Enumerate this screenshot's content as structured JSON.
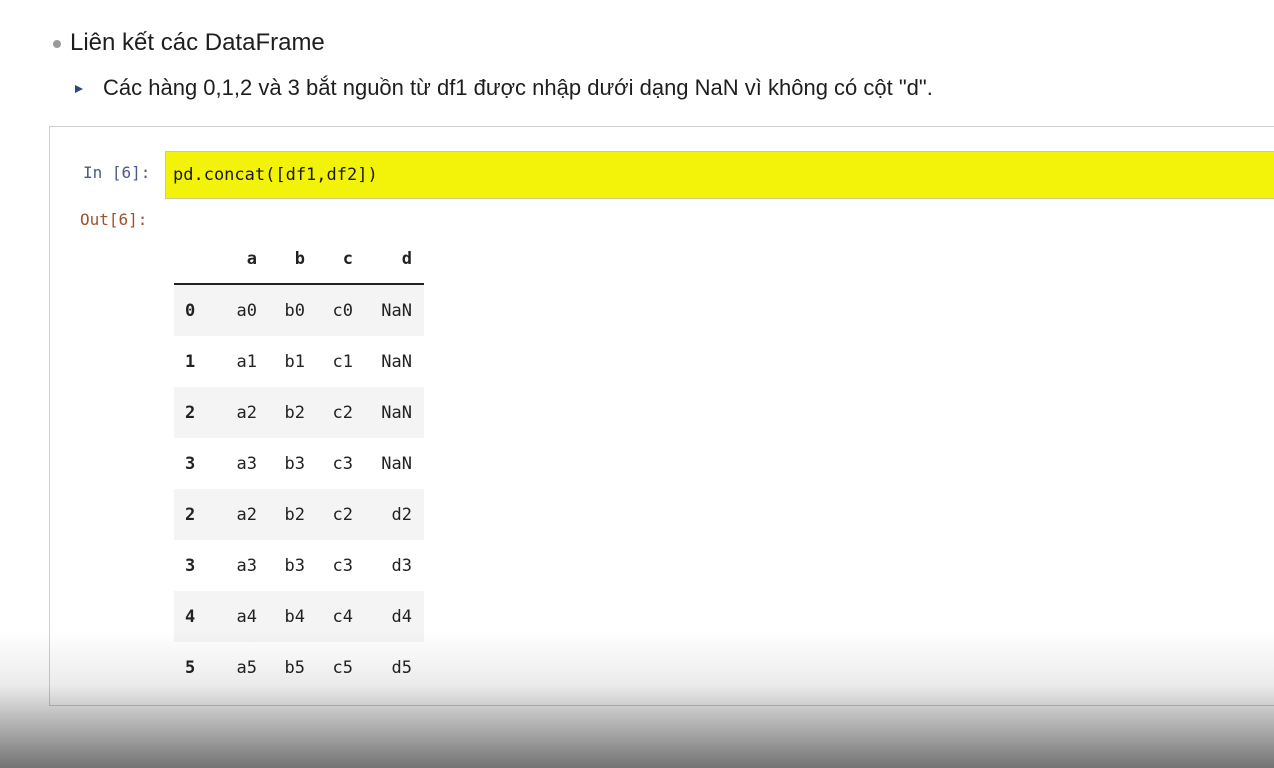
{
  "slide": {
    "heading": "Liên kết các DataFrame",
    "sub_bullet": "Các hàng 0,1,2 và 3 bắt nguồn từ df1 được nhập dưới dạng NaN vì không có cột \"d\"."
  },
  "cell": {
    "in_prompt": "In [6]:",
    "code": "pd.concat([df1,df2])",
    "out_prompt": "Out[6]:"
  },
  "dataframe": {
    "columns": [
      "a",
      "b",
      "c",
      "d"
    ],
    "rows": [
      {
        "index": "0",
        "a": "a0",
        "b": "b0",
        "c": "c0",
        "d": "NaN"
      },
      {
        "index": "1",
        "a": "a1",
        "b": "b1",
        "c": "c1",
        "d": "NaN"
      },
      {
        "index": "2",
        "a": "a2",
        "b": "b2",
        "c": "c2",
        "d": "NaN"
      },
      {
        "index": "3",
        "a": "a3",
        "b": "b3",
        "c": "c3",
        "d": "NaN"
      },
      {
        "index": "2",
        "a": "a2",
        "b": "b2",
        "c": "c2",
        "d": "d2"
      },
      {
        "index": "3",
        "a": "a3",
        "b": "b3",
        "c": "c3",
        "d": "d3"
      },
      {
        "index": "4",
        "a": "a4",
        "b": "b4",
        "c": "c4",
        "d": "d4"
      },
      {
        "index": "5",
        "a": "a5",
        "b": "b5",
        "c": "c5",
        "d": "d5"
      }
    ]
  },
  "colors": {
    "code_highlight": "#f3f30a",
    "in_prompt": "#4a5a8a",
    "out_prompt": "#a0522d"
  }
}
